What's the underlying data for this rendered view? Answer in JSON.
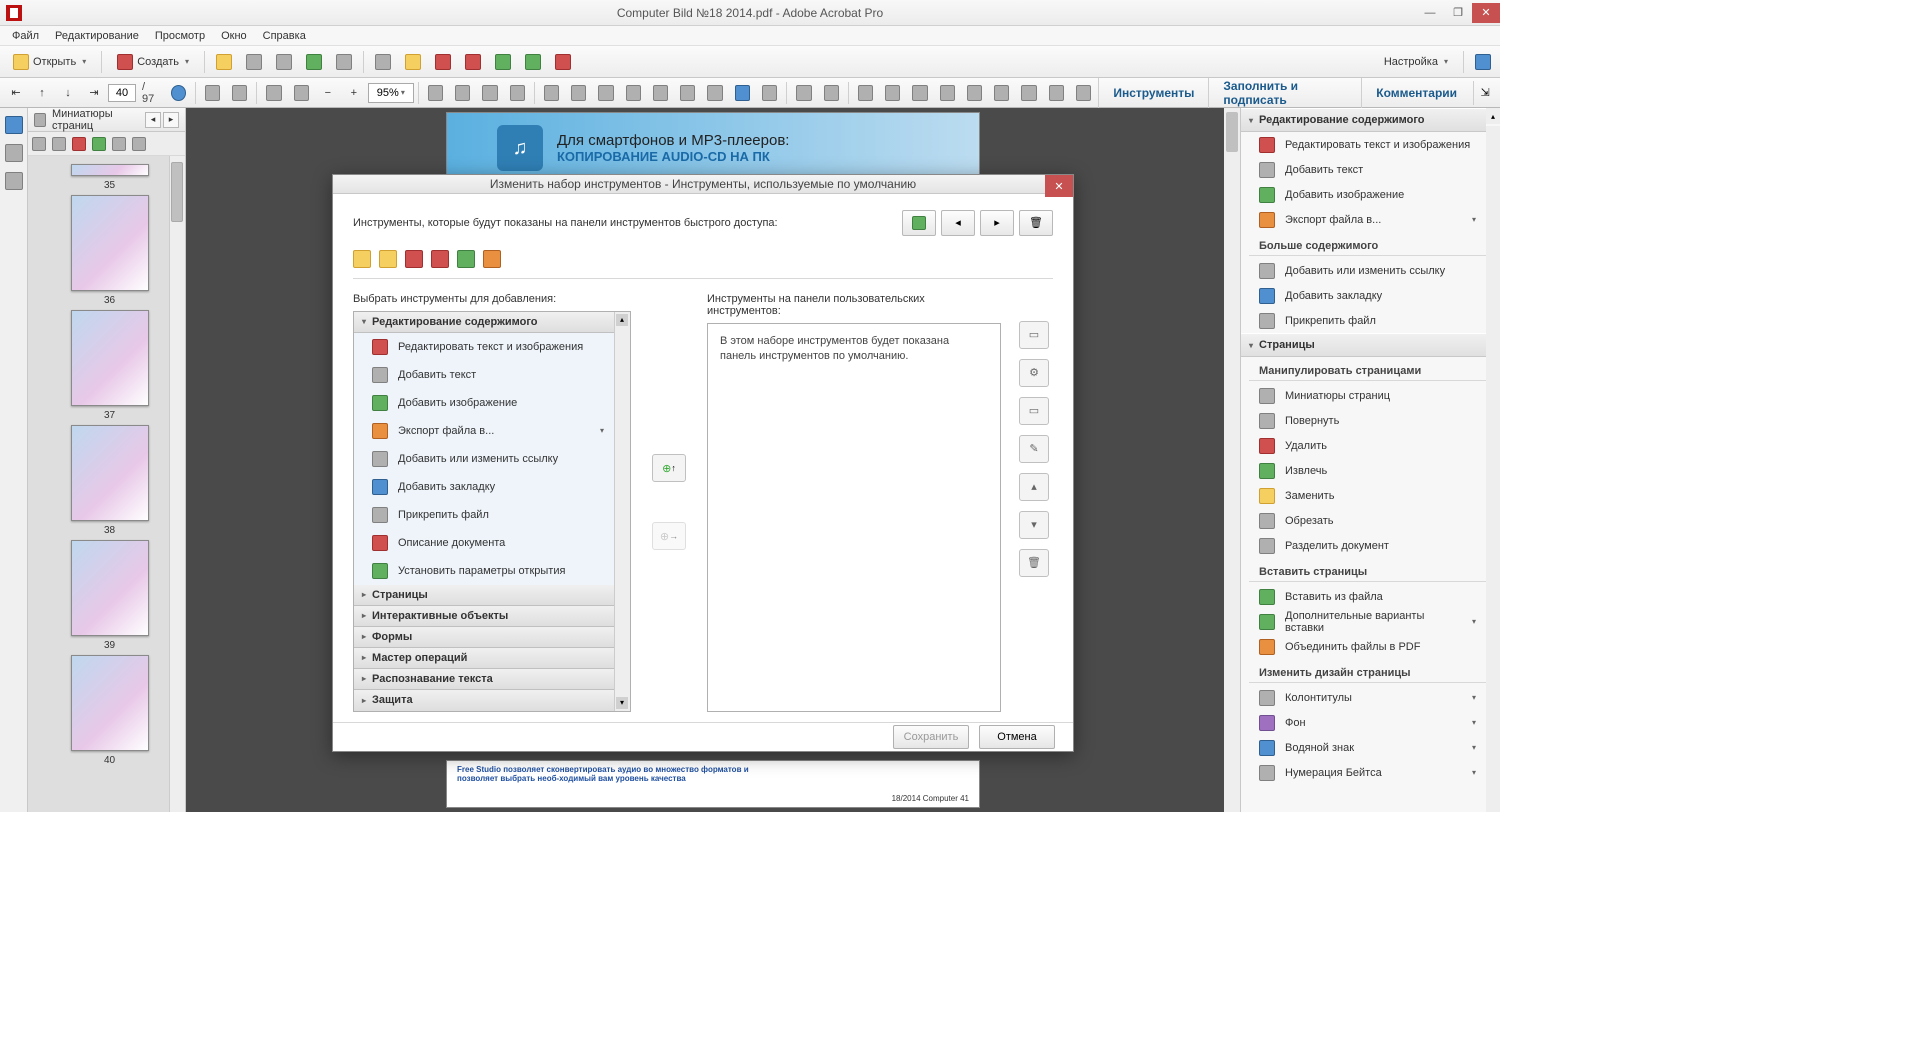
{
  "titlebar": {
    "title": "Computer Bild №18 2014.pdf - Adobe Acrobat Pro"
  },
  "menubar": [
    "Файл",
    "Редактирование",
    "Просмотр",
    "Окно",
    "Справка"
  ],
  "toolbar1": {
    "open": "Открыть",
    "create": "Создать",
    "settings": "Настройка"
  },
  "toolbar2": {
    "page_current": "40",
    "page_total": "/ 97",
    "zoom": "95%"
  },
  "right_tabs": [
    "Инструменты",
    "Заполнить и подписать",
    "Комментарии"
  ],
  "thumbs": {
    "title": "Миниатюры страниц",
    "items": [
      "35",
      "36",
      "37",
      "38",
      "39",
      "40"
    ]
  },
  "doc_preview": {
    "line1": "Для смартфонов и MP3-плееров:",
    "line2": "КОПИРОВАНИЕ AUDIO-CD НА ПК",
    "bottom_text": "Free Studio позволяет сконвертировать аудио во множество форматов и позволяет выбрать необ-ходимый вам уровень качества",
    "bottom_pageinfo": "18/2014   Computer  41"
  },
  "rightpanel": {
    "sec1": {
      "title": "Редактирование содержимого",
      "items": [
        "Редактировать текст и изображения",
        "Добавить текст",
        "Добавить изображение",
        "Экспорт файла в..."
      ],
      "sub1": "Больше содержимого",
      "items2": [
        "Добавить или изменить ссылку",
        "Добавить закладку",
        "Прикрепить файл"
      ]
    },
    "sec2": {
      "title": "Страницы",
      "sub1": "Манипулировать страницами",
      "items1": [
        "Миниатюры страниц",
        "Повернуть",
        "Удалить",
        "Извлечь",
        "Заменить",
        "Обрезать",
        "Разделить документ"
      ],
      "sub2": "Вставить страницы",
      "items2": [
        "Вставить из файла",
        "Дополнительные варианты вставки",
        "Объединить файлы в PDF"
      ],
      "sub3": "Изменить дизайн страницы",
      "items3": [
        "Колонтитулы",
        "Фон",
        "Водяной знак",
        "Нумерация Бейтса"
      ]
    }
  },
  "dialog": {
    "title": "Изменить набор инструментов - Инструменты, используемые по умолчанию",
    "row1_label": "Инструменты, которые будут показаны на панели инструментов быстрого доступа:",
    "left_label": "Выбрать инструменты для добавления:",
    "right_label": "Инструменты на панели пользовательских инструментов:",
    "right_msg": "В этом наборе инструментов будет показана панель инструментов по умолчанию.",
    "acc_open": "Редактирование содержимого",
    "acc_items": [
      "Редактировать текст и изображения",
      "Добавить текст",
      "Добавить изображение",
      "Экспорт файла в...",
      "Добавить или изменить ссылку",
      "Добавить закладку",
      "Прикрепить файл",
      "Описание документа",
      "Установить параметры открытия"
    ],
    "acc_closed": [
      "Страницы",
      "Интерактивные объекты",
      "Формы",
      "Мастер операций",
      "Распознавание текста",
      "Защита"
    ],
    "save": "Сохранить",
    "cancel": "Отмена"
  }
}
